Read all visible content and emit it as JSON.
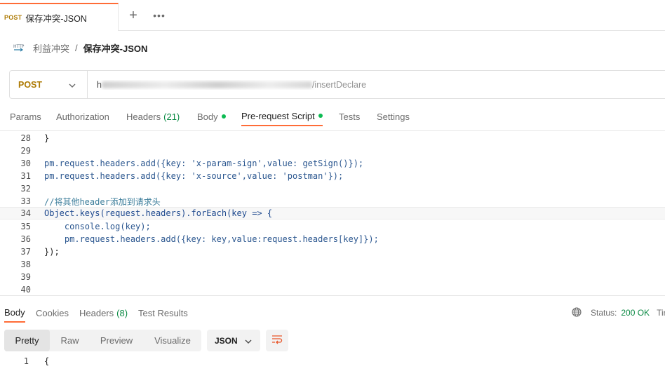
{
  "tab": {
    "method": "POST",
    "title": "保存冲突-JSON",
    "plus": "+",
    "more": "•••"
  },
  "breadcrumb": {
    "parent": "利益冲突",
    "separator": "/",
    "current": "保存冲突-JSON"
  },
  "request": {
    "method": "POST",
    "url_visible_start": "h",
    "url_visible_end": "/insertDeclare"
  },
  "request_tabs": [
    {
      "label": "Params",
      "count": "",
      "dot": false
    },
    {
      "label": "Authorization",
      "count": "",
      "dot": false
    },
    {
      "label": "Headers",
      "count": "(21)",
      "dot": false
    },
    {
      "label": "Body",
      "count": "",
      "dot": true
    },
    {
      "label": "Pre-request Script",
      "count": "",
      "dot": true,
      "active": true
    },
    {
      "label": "Tests",
      "count": "",
      "dot": false
    },
    {
      "label": "Settings",
      "count": "",
      "dot": false
    }
  ],
  "script_lines": [
    {
      "n": "28",
      "text": "}"
    },
    {
      "n": "29",
      "text": ""
    },
    {
      "n": "30",
      "text": "pm.request.headers.add({key: 'x-param-sign',value: getSign()});"
    },
    {
      "n": "31",
      "text": "pm.request.headers.add({key: 'x-source',value: 'postman'});"
    },
    {
      "n": "32",
      "text": ""
    },
    {
      "n": "33",
      "text": "//将其他header添加到请求头"
    },
    {
      "n": "34",
      "text": "Object.keys(request.headers).forEach(key => {"
    },
    {
      "n": "35",
      "text": "    console.log(key);"
    },
    {
      "n": "36",
      "text": "    pm.request.headers.add({key: key,value:request.headers[key]});"
    },
    {
      "n": "37",
      "text": "});"
    },
    {
      "n": "38",
      "text": ""
    },
    {
      "n": "39",
      "text": ""
    },
    {
      "n": "40",
      "text": ""
    }
  ],
  "response_tabs": [
    {
      "label": "Body",
      "count": "",
      "active": true
    },
    {
      "label": "Cookies",
      "count": ""
    },
    {
      "label": "Headers",
      "count": "(8)"
    },
    {
      "label": "Test Results",
      "count": ""
    }
  ],
  "status": {
    "label": "Status:",
    "value": "200 OK",
    "next": "Tir"
  },
  "view_modes": [
    "Pretty",
    "Raw",
    "Preview",
    "Visualize"
  ],
  "active_view": "Pretty",
  "format": "JSON",
  "response_lines": [
    {
      "n": "1",
      "text": "{"
    }
  ],
  "colors": {
    "accent": "#ff6c37",
    "method_post": "#ad7a03",
    "success": "#0b8a44",
    "dot": "#0cbb52"
  }
}
